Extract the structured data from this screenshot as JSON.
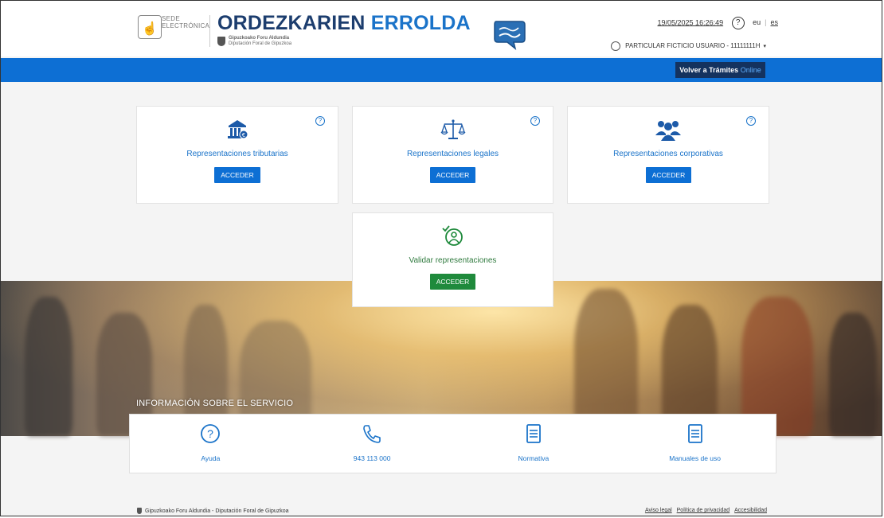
{
  "header": {
    "sede_text": [
      "SEDE",
      "ELECTRÓNICA"
    ],
    "title_part1": "ORDEZKARIEN",
    "title_part2": "ERROLDA",
    "org_line1": "Gipuzkoako Foru Aldundia",
    "org_line2": "Diputación Foral de Gipuzkoa",
    "datetime": "19/05/2025 16:26:49",
    "help_icon_glyph": "?",
    "lang_eu": "eu",
    "lang_es": "es",
    "user_label": "PARTICULAR FICTICIO USUARIO - 11111111H",
    "caret": "▾"
  },
  "bluebar": {
    "back_label": "Volver a Trámites",
    "back_label_online": "Online"
  },
  "cards": [
    {
      "icon": "bank-euro-icon",
      "label": "Representaciones tributarias",
      "button": "ACCEDER",
      "help": "?"
    },
    {
      "icon": "scales-icon",
      "label": "Representaciones legales",
      "button": "ACCEDER",
      "help": "?"
    },
    {
      "icon": "people-group-icon",
      "label": "Representaciones corporativas",
      "button": "ACCEDER",
      "help": "?"
    },
    {
      "icon": "user-check-icon",
      "label": "Validar representaciones",
      "button": "ACCEDER"
    }
  ],
  "info": {
    "title": "INFORMACIÓN SOBRE EL SERVICIO",
    "items": [
      {
        "icon": "help-circle-icon",
        "label": "Ayuda"
      },
      {
        "icon": "phone-icon",
        "label": "943 113 000"
      },
      {
        "icon": "document-icon",
        "label": "Normativa"
      },
      {
        "icon": "document-icon",
        "label": "Manuales de uso"
      }
    ]
  },
  "footer": {
    "org": "Gipuzkoako Foru Aldundia - Diputación Foral de Gipuzkoa",
    "links": [
      "Aviso legal",
      "Política de privacidad",
      "Accesibilidad"
    ]
  },
  "colors": {
    "primary_blue": "#0d6fd4",
    "dark_navy": "#14325e",
    "green": "#1f8a3c",
    "link_blue": "#1a73c9"
  }
}
